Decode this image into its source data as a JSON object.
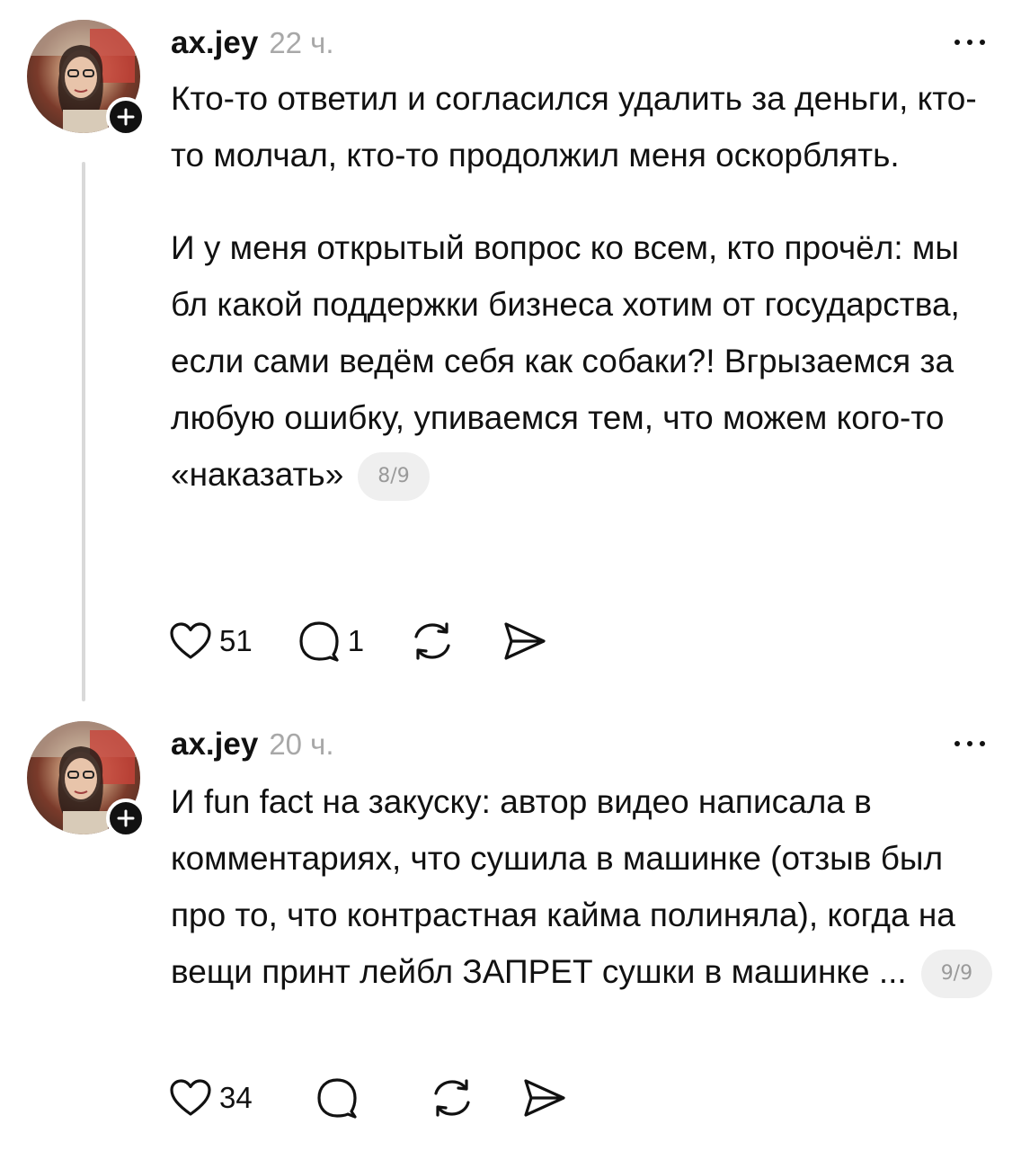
{
  "posts": [
    {
      "username": "ax.jey",
      "time": "22 ч.",
      "paragraphs": [
        "Кто-то ответил и согласился удалить за деньги, кто-то молчал, кто-то продолжил меня оскорблять.",
        "И у меня открытый вопрос ко всем, кто прочёл: мы бл какой поддержки бизнеса хотим от государства, если сами ведём себя как собаки?! Вгрызаемся за любую ошибку, упиваемся тем, что можем кого-то «наказать»"
      ],
      "pager": "8/9",
      "likes": "51",
      "comments": "1"
    },
    {
      "username": "ax.jey",
      "time": "20 ч.",
      "paragraphs": [
        "И fun fact на закуску: автор видео написала в комментариях, что сушила в машинке (отзыв был про то, что контрастная кайма полиняла), когда на вещи принт лейбл ЗАПРЕТ сушки в машинке ..."
      ],
      "pager": "9/9",
      "likes": "34",
      "comments": ""
    }
  ],
  "icons": {
    "like": "heart-icon",
    "comment": "comment-icon",
    "repost": "repost-icon",
    "share": "send-icon",
    "more": "more-dots-icon",
    "follow": "plus-icon"
  }
}
